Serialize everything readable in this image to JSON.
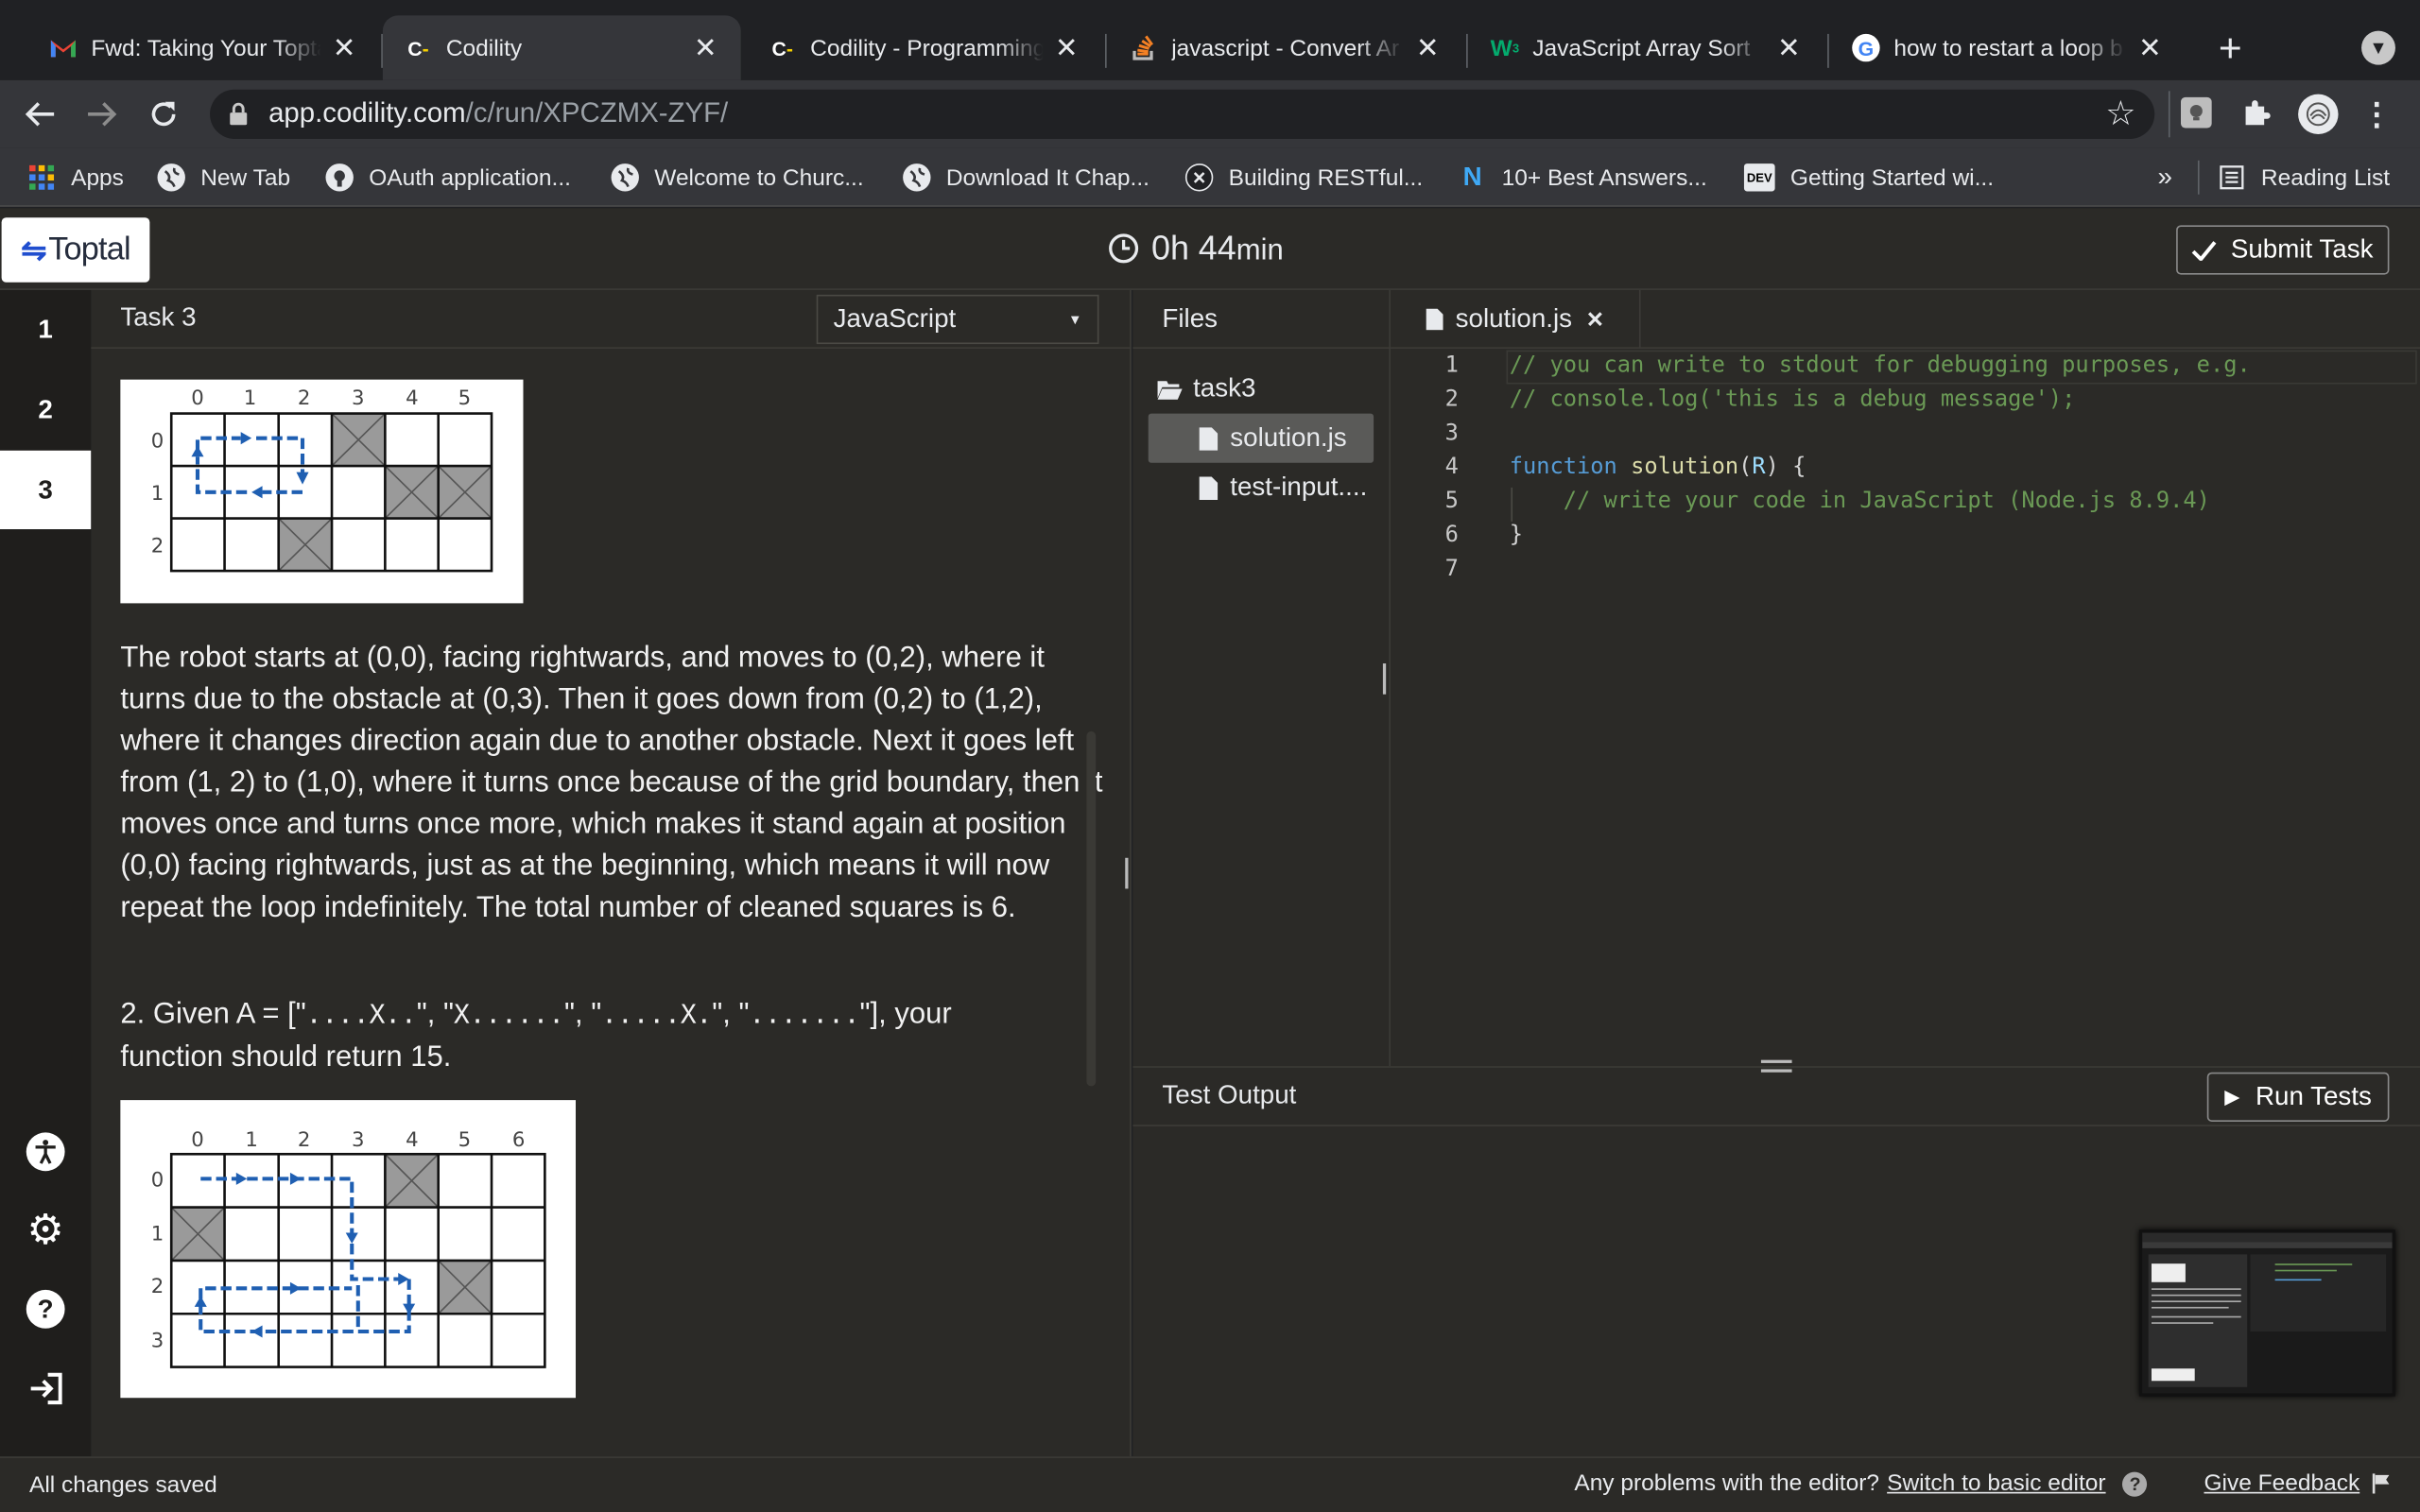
{
  "browser": {
    "tabs": [
      {
        "title": "Fwd: Taking Your Topta",
        "favicon": "gmail-icon",
        "active": false
      },
      {
        "title": "Codility",
        "favicon": "codility-icon",
        "active": true
      },
      {
        "title": "Codility - Programming",
        "favicon": "codility-icon",
        "active": false
      },
      {
        "title": "javascript - Convert Ar",
        "favicon": "stackoverflow-icon",
        "active": false
      },
      {
        "title": "JavaScript Array Sort",
        "favicon": "w3schools-icon",
        "active": false
      },
      {
        "title": "how to restart a loop b",
        "favicon": "google-icon",
        "active": false
      }
    ],
    "url_host": "app.codility.com",
    "url_path": "/c/run/XPCZMX-ZYF/",
    "bookmarks": [
      {
        "label": "Apps",
        "icon": "apps-grid-icon"
      },
      {
        "label": "New Tab",
        "icon": "globe-icon"
      },
      {
        "label": "OAuth application...",
        "icon": "github-icon"
      },
      {
        "label": "Welcome to Churc...",
        "icon": "globe-icon"
      },
      {
        "label": "Download It Chap...",
        "icon": "globe-icon"
      },
      {
        "label": "Building RESTful...",
        "icon": "x-circle-icon"
      },
      {
        "label": "10+ Best Answers...",
        "icon": "n-logo-icon"
      },
      {
        "label": "Getting Started wi...",
        "icon": "dev-logo-icon"
      }
    ],
    "more_bookmarks": "»",
    "reading_list": "Reading List"
  },
  "app": {
    "logo": "Toptal",
    "timer_hours": "0h",
    "timer_minutes": "44",
    "timer_unit": "min",
    "submit_label": "Submit Task",
    "task_numbers": [
      "1",
      "2",
      "3"
    ],
    "active_task": "3",
    "task_title": "Task 3",
    "language": "JavaScript",
    "description": {
      "paragraph1": "The robot starts at (0,0), facing rightwards, and moves to (0,2), where it turns due to the obstacle at (0,3). Then it goes down from (0,2) to (1,2), where it changes direction again due to another obstacle. Next it goes left from (1, 2) to (1,0), where it turns once because of the grid boundary, then it moves once and turns once more, which makes it stand again at position (0,0) facing rightwards, just as at the beginning, which means it will now repeat the loop indefinitely. The total number of cleaned squares is 6.",
      "example2_prefix": "2. Given A = [\"",
      "example2_code1": "....X..",
      "example2_sep1": "\", \"",
      "example2_code2": "X......",
      "example2_sep2": "\", \"",
      "example2_code3": ".....X.",
      "example2_sep3": "\", \"",
      "example2_code4": ".......",
      "example2_suffix": "\"], your",
      "example2_line2": "function should return 15."
    },
    "grid1": {
      "cols": [
        "0",
        "1",
        "2",
        "3",
        "4",
        "5"
      ],
      "rows": [
        "0",
        "1",
        "2"
      ]
    },
    "grid2": {
      "cols": [
        "0",
        "1",
        "2",
        "3",
        "4",
        "5",
        "6"
      ],
      "rows": [
        "0",
        "1",
        "2",
        "3"
      ]
    },
    "files_title": "Files",
    "folder": "task3",
    "file_list": [
      "solution.js",
      "test-input...."
    ],
    "editor_tab": "solution.js",
    "code_lines": [
      {
        "n": "1",
        "text": "// you can write to stdout for debugging purposes, e.g."
      },
      {
        "n": "2",
        "text": "// console.log('this is a debug message');"
      },
      {
        "n": "3",
        "text": ""
      },
      {
        "n": "4",
        "kw": "function",
        "fn": "solution",
        "p1": "(",
        "arg": "R",
        "p2": ") {"
      },
      {
        "n": "5",
        "text": "    // write your code in JavaScript (Node.js 8.9.4)"
      },
      {
        "n": "6",
        "text": "}"
      },
      {
        "n": "7",
        "text": ""
      }
    ],
    "test_output_title": "Test Output",
    "run_tests_label": "Run Tests",
    "status": "All changes saved",
    "problems_text": "Any problems with the editor?",
    "switch_editor_link": "Switch to basic editor",
    "feedback_link": "Give Feedback"
  }
}
